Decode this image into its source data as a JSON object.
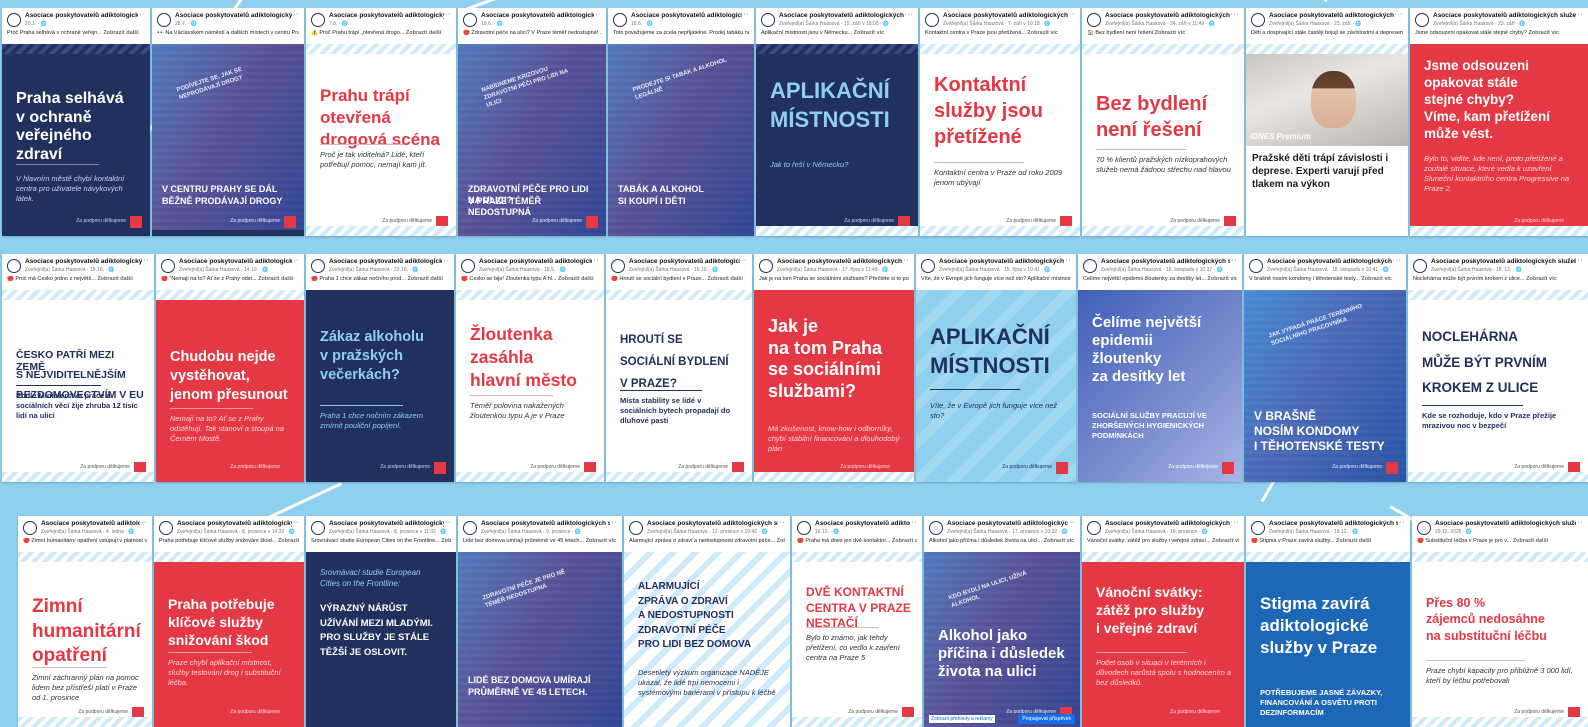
{
  "colors": {
    "background": "#8fd0ee",
    "navy": "#22305e",
    "red": "#e53845",
    "light_blue": "#8fd0ee",
    "white": "#ffffff"
  },
  "org_full": "Asociace poskytovatelů adiktologických služeb",
  "posts": [
    {
      "id": "r1c1",
      "org": "Asociace poskytovatelů adiktologických služeb",
      "meta": "20.1. · 🌐",
      "text": "Proč Praha selhává v ochraně veřejn...",
      "more": "Zobrazit další",
      "heading": [
        "Praha selhává",
        "v ochraně",
        "veřejného zdraví"
      ],
      "sub": "V hlavním městě chybí kontaktní centra pro uživatele návykových látek.",
      "credit": "Za podporu dělkujeme"
    },
    {
      "id": "r1c2",
      "org": "Asociace poskytovatelů adiktologických služeb",
      "meta": "28.7. · 🌐",
      "text": "👀 Na Václavském náměstí a dalších místech v centru Prahy se dál prodávají drogy.",
      "more": "Zobrazit další",
      "tilted": "Podívejte se, jak se neprodávají drogy",
      "caption": [
        "V CENTRU PRAHY SE DÁL",
        "BĚŽNĚ PRODÁVAJÍ DROGY"
      ],
      "credit": "Za podporu dělkujeme"
    },
    {
      "id": "r1c3",
      "org": "Asociace poskytovatelů adiktologických služeb",
      "meta": "7.8. · 🌐",
      "text": "⚠️ Proč Prahu trápí „otevřená drogo...",
      "more": "Zobrazit další",
      "heading": [
        "Prahu trápí",
        "otevřená",
        "drogová scéna"
      ],
      "sub": "Proč je tak viditelná? Lidé, kteří potřebují pomoc, nemají kam jít.",
      "credit": "Za podporu dělkujeme"
    },
    {
      "id": "r1c4",
      "org": "Asociace poskytovatelů adiktologických služeb",
      "meta": "19.6. · 🌐",
      "text": "🔴 Zdravotní péče na ulici? V Praze téměř nedostupná! ...",
      "more": "Zobrazit další",
      "tilted": "Nabídneme krizovou zdravotní péči pro lidi na ulici",
      "caption": [
        "ZDRAVOTNÍ PÉČE PRO LIDI NA ULICI?",
        "V PRAZE TÉMĚŘ NEDOSTUPNÁ"
      ],
      "credit": "Za podporu dělkujeme"
    },
    {
      "id": "r1c5",
      "org": "Asociace poskytovatelů adiktologických služeb",
      "meta": "16.6. · 🌐",
      "text": "Toto považujeme za zcela nepřijatelné. Prodej tabáku nezletilým cigarety nebo lihoviny? An...",
      "more": "Zobrazit další",
      "tilted": "Prodejte si tabák a alkohol legálně",
      "caption": [
        "TABÁK A ALKOHOL",
        "SI KOUPÍ I DĚTI"
      ],
      "credit": ""
    },
    {
      "id": "r1c6",
      "org": "Asociace poskytovatelů adiktologických služeb",
      "meta": "Zveřejnil(a) Šárka Haasová · 15. září v 18:00 · 🌐",
      "text": "Aplikační místnosti jsou v Německu...",
      "more": "Zobrazit víc",
      "heading": [
        "APLIKAČNÍ",
        "MÍSTNOSTI"
      ],
      "sub": "Jak to řeší v Německu?",
      "credit": "Za podporu dělkujeme"
    },
    {
      "id": "r1c7",
      "org": "Asociace poskytovatelů adiktologických služeb",
      "meta": "Zveřejnil(a) Šárka Haasová · 7. září v 10:18 · 🌐",
      "text": "Kontaktní centra v Praze jsou přetížená...",
      "more": "Zobrazit víc",
      "heading": [
        "Kontaktní",
        "služby jsou",
        "přetížené"
      ],
      "sub": "Kontaktní centra v Praze od roku 2009 jenom ubývají",
      "credit": "Za podporu dělkujeme"
    },
    {
      "id": "r1c8",
      "org": "Asociace poskytovatelů adiktologických služeb",
      "meta": "Zveřejnil(a) Šárka Haasová · 24. září v 11:49 · 🌐",
      "text": "🏠 Bez bydlení není řešení",
      "more": "Zobrazit víc",
      "heading": [
        "Bez bydlení",
        "není řešení"
      ],
      "sub": "70 % klientů pražských nízkoprahových služeb nemá žádnou střechu nad hlavou",
      "credit": "Za podporu dělkujeme"
    },
    {
      "id": "r1c9",
      "org": "Asociace poskytovatelů adiktologických služeb",
      "meta": "Zveřejnil(a) Šárka Haasová · 23. září · 🌐",
      "text": "Děti a dospívající stále častěji bojují se závislostmi a depresemi...",
      "more": "Zobrazit víc",
      "premium": "iDNES Premium",
      "news": "Pražské děti trápí závislosti i deprese. Experti varují před tlakem na výkon"
    },
    {
      "id": "r1c10",
      "org": "Asociace poskytovatelů adiktologických služeb",
      "meta": "Zveřejnil(a) Šárka Haasová · 23. září · 🌐",
      "text": "Jsme odsouzeni opakovat stále stejné chyby?",
      "more": "Zobrazit víc",
      "heading": [
        "Jsme odsouzeni",
        "opakovat stále",
        "stejné chyby?",
        "Víme, kam přetížení",
        "může vést."
      ],
      "sub": "Bylo to, vidíte, kde není, proto přetížené a zoufalé situace, které vedla k uzavření Sluneční kontaktního centra Progressive na Praze 2.",
      "credit": "Za podporu dělkujeme"
    },
    {
      "id": "r2c1",
      "org": "Asociace poskytovatelů adiktologických služeb",
      "meta": "Zveřejnil(a) Šárka Haasová · 15.10. · 🌐",
      "text": "🔴 Proč má Česko jedno z největš...",
      "more": "Zobrazit další",
      "heading": [
        "ČESKO PATŘÍ MEZI ZEMĚ",
        "S NEJVIDITELNĚJŠÍM",
        "BEZDOMOVECTVÍM V EU"
      ],
      "sub": "Podle Ministerstva práce a sociálních věcí žije zhruba 12 tisíc lidí na ulici",
      "credit": "Za podporu dělkujeme"
    },
    {
      "id": "r2c2",
      "org": "Asociace poskytovatelů adiktologických služeb",
      "meta": "Zveřejnil(a) Šárka Haasová · 14.10. · 🌐",
      "text": "🔴 \"Nemají na to? Ať se z Prahy odst...",
      "more": "Zobrazit další",
      "heading": [
        "Chudobu nejde",
        "vystěhovat,",
        "jenom přesunout"
      ],
      "sub": "Nemají na to? Ať se z Prahy odstěhují. Tak stanoví a stoupá na Černém Mostě.",
      "credit": "Za podporu dělkujeme"
    },
    {
      "id": "r2c3",
      "org": "Asociace poskytovatelů adiktologických služeb",
      "meta": "Zveřejnil(a) Šárka Haasová · 23.10. · 🌐",
      "text": "🔴 Praha 1 chce zákaz nočního prod...",
      "more": "Zobrazit další",
      "heading": [
        "Zákaz alkoholu",
        "v pražských",
        "večerkách?"
      ],
      "sub": "Praha 1 chce nočním zákazem zmírnit pouliční popíjení.",
      "credit": "Za podporu dělkujeme"
    },
    {
      "id": "r2c4",
      "org": "Asociace poskytovatelů adiktologických služeb",
      "meta": "Zveřejnil(a) Šárka Haasová · 18.9. · 🌐",
      "text": "🔴 Česko se bije! Žloutenka typu A hl...",
      "more": "Zobrazit další",
      "heading": [
        "Žloutenka",
        "zasáhla",
        "hlavní město"
      ],
      "sub": "Téměř polovina nakažených žloutenkou typu A je v Praze",
      "credit": "Za podporu dělkujeme"
    },
    {
      "id": "r2c5",
      "org": "Asociace poskytovatelů adiktologických služeb",
      "meta": "Zveřejnil(a) Šárka Haasová · 16.10. · 🌐",
      "text": "🔴 Hroutí se sociální bydlení v Praze...",
      "more": "Zobrazit další",
      "heading": [
        "HROUTÍ SE",
        "SOCIÁLNÍ BYDLENÍ",
        "V PRAZE?"
      ],
      "sub": "Místa stability se lidé v sociálních bytech propadají do dluhové pasti",
      "credit": "Za podporu dělkujeme"
    },
    {
      "id": "r2c6",
      "org": "Asociace poskytovatelů adiktologických služeb",
      "meta": "Zveřejnil(a) Šárka Haasová · 17. října v 11:49 · 🌐",
      "text": "Jak je na tom Praha se sociálními službami? Přečtěte si to podrobněji...",
      "more": "Zobrazit víc",
      "heading": [
        "Jak je",
        "na tom Praha",
        "se sociálními",
        "službami?"
      ],
      "sub": "Má zkušenost, know-how i odborníky, chybí stabilní financování a dlouhodobý plán",
      "credit": "Za podporu dělkujeme"
    },
    {
      "id": "r2c7",
      "org": "Asociace poskytovatelů adiktologických služeb",
      "meta": "Zveřejnil(a) Šárka Haasová · 15. října v 10:41 · 🌐",
      "text": "Víte, že v Evropě jich funguje více než sto? Aplikační místnosti...",
      "more": "Zobrazit víc",
      "heading": [
        "APLIKAČNÍ",
        "MÍSTNOSTI"
      ],
      "sub": "Víte, že v Evropě jich funguje více než sto?",
      "credit": "Za podporu dělkujeme"
    },
    {
      "id": "r2c8",
      "org": "Asociace poskytovatelů adiktologických služeb",
      "meta": "Zveřejnil(a) Šárka Haasová · 16. listopadu v 10:37 · 🌐",
      "text": "Čelíme největší epidemii žloutenky za desítky let...",
      "more": "Zobrazit víc",
      "heading": [
        "Čelíme největší",
        "epidemii",
        "žloutenky",
        "za desítky let"
      ],
      "sub": "SOCIÁLNÍ SLUŽBY PRACUJÍ VE ZHORŠENÝCH HYGIENICKÝCH PODMÍNKÁCH",
      "credit": "Za podporu dělkujeme"
    },
    {
      "id": "r2c9",
      "org": "Asociace poskytovatelů adiktologických služeb",
      "meta": "Zveřejnil(a) Šárka Haasová · 18. listopadu v 10:41 · 🌐",
      "text": "V brašně nosím kondomy i těhotenské testy...",
      "more": "Zobrazit víc",
      "tilted": "Jak vypadá práce terénního sociálního pracovníka",
      "caption": [
        "V BRAŠNĚ",
        "NOSÍM KONDOMY",
        "I TĚHOTENSKÉ TESTY"
      ],
      "credit": "Za podporu dělkujeme"
    },
    {
      "id": "r2c10",
      "org": "Asociace poskytovatelů adiktologických služeb",
      "meta": "Zveřejnil(a) Šárka Haasová · 18. 12. · 🌐",
      "text": "Noclehárna může být prvním krokem z ulice...",
      "more": "Zobrazit víc",
      "heading": [
        "NOCLEHÁRNA",
        "MŮŽE BÝT PRVNÍM",
        "KROKEM Z ULICE"
      ],
      "sub": "Kde se rozhoduje, kdo v Praze přežije mrazivou noc v bezpečí",
      "credit": "Za podporu dělkujeme"
    },
    {
      "id": "r3c1",
      "org": "Asociace poskytovatelů adiktologických služeb",
      "meta": "Zveřejnil(a) Šárka Haasová · 4. ledna · 🌐",
      "text": "🔴 Zimní humanitární opatření vstupují v platnost v posledních 1. prosince...",
      "more": "Zobrazit další",
      "heading": [
        "Zimní",
        "humanitární",
        "opatření"
      ],
      "sub": "Zimní záchranný plán na pomoc lidem bez přístřeší platí v Praze od 1. prosince",
      "credit": "Za podporu dělkujeme"
    },
    {
      "id": "r3c2",
      "org": "Asociace poskytovatelů adiktologických služeb",
      "meta": "Zveřejnil(a) Šárka Haasová · 8. prosince v 14:33 · 🌐",
      "text": "Praha potřebuje klíčové služby snižování škod...",
      "more": "Zobrazit víc",
      "heading": [
        "Praha potřebuje",
        "klíčové služby",
        "snižování škod"
      ],
      "sub": "Praze chybí aplikační místnost, služby testování drog i substituční léčba.",
      "credit": "Za podporu dělkujeme"
    },
    {
      "id": "r3c3",
      "org": "Asociace poskytovatelů adiktologických služeb",
      "meta": "Zveřejnil(a) Šárka Haasová · 8. prosince v 11:02 · 🌐",
      "text": "Srovnávací studie European Cities on the Frontline...",
      "more": "Zobrazit víc",
      "lead": [
        "Srovnávací studie European",
        "Cities on the Frontline:"
      ],
      "heading": [
        "VÝRAZNÝ NÁRŮST",
        "UŽÍVÁNÍ MEZI MLADÝMI.",
        "PRO SLUŽBY JE STÁLE",
        "TĚŽŠÍ JE OSLOVIT."
      ],
      "credit": ""
    },
    {
      "id": "r3c4",
      "org": "Asociace poskytovatelů adiktologických služeb",
      "meta": "Zveřejnil(a) Šárka Haasová · 9. prosince · 🌐",
      "text": "Lidé bez domova umírají průměrně ve 45 letech...",
      "more": "Zobrazit víc",
      "tilted": "Zdravotní péče je pro ně téměř nedostupná",
      "caption": [
        "LIDÉ BEZ DOMOVA UMÍRAJÍ",
        "PRŮMĚRNĚ VE 45 LETECH."
      ],
      "credit": ""
    },
    {
      "id": "r3c5",
      "org": "Asociace poskytovatelů adiktologických služeb",
      "meta": "Zveřejnil(a) Šárka Haasová · 12. prosince v 10:42 · 🌐",
      "text": "Alarmující zpráva o zdraví a nedostupnosti zdravotní péče...",
      "more": "Zobrazit víc",
      "heading": [
        "ALARMUJÍCÍ",
        "ZPRÁVA O ZDRAVÍ",
        "A NEDOSTUPNOSTI",
        "ZDRAVOTNÍ PÉČE",
        "PRO LIDI BEZ DOMOVA"
      ],
      "sub": "Desetiletý výzkum organizace NADĚJE ukázal, že lidé trpí nemocemi i systémovými bariérami v přístupu k léčbě",
      "credit": ""
    },
    {
      "id": "r3c6",
      "org": "Asociace poskytovatelů adiktologických služeb",
      "meta": "16.12. · 🌐",
      "text": "🔴 Praha má dnes jen dvě kontaktní...",
      "more": "Zobrazit další",
      "heading": [
        "DVĚ KONTAKTNÍ",
        "CENTRA V PRAZE",
        "NESTAČÍ"
      ],
      "sub": "Bylo to známo, jak tehdy přetížení, co vedlo k zavření centra na Praze 5",
      "credit": "Za podporu dělkujeme"
    },
    {
      "id": "r3c7",
      "org": "Asociace poskytovatelů adiktologických služeb",
      "meta": "Zveřejnil(a) Šárka Haasová · 17. prosince v 10:32 · 🌐",
      "text": "Alkohol jako příčina i důsledek života na ulici...",
      "more": "Zobrazit víc",
      "tilted": "Kdo bydlí na ulici, užívá alkohol",
      "heading": [
        "Alkohol jako",
        "příčina i důsledek",
        "života na ulici"
      ],
      "credit": "Za podporu dělkujeme",
      "footer_left": "Zobrazit přehledy a reklamy",
      "footer_btn": "Propagovat příspěvek"
    },
    {
      "id": "r3c8",
      "org": "Asociace poskytovatelů adiktologických služeb",
      "meta": "Zveřejnil(a) Šárka Haasová · 19. prosince · 🌐",
      "text": "Vánoční svátky: zátěž pro služby i veřejné zdraví...",
      "more": "Zobrazit víc",
      "heading": [
        "Vánoční svátky:",
        "zátěž pro služby",
        "i veřejné zdraví"
      ],
      "sub": "Počet osob v situaci v terénních i důvodech narůstá spolu s hodnocením a bez důsledků.",
      "credit": "Za podporu dělkujeme"
    },
    {
      "id": "r3c9",
      "org": "Asociace poskytovatelů adiktologických služeb",
      "meta": "Zveřejnil(a) Šárka Haasová · 19.12. · 🌐",
      "text": "🔴 Stigma v Praze zavírá služby...",
      "more": "Zobrazit další",
      "heading": [
        "Stigma zavírá",
        "adiktologické",
        "služby v Praze"
      ],
      "sub": "POTŘEBUJEME JASNÉ ZÁVAZKY, FINANCOVÁNÍ A OSVĚTU PROTI DEZINFORMACÍM",
      "credit": ""
    },
    {
      "id": "r3c10",
      "org": "Asociace poskytovatelů adiktologických služeb",
      "meta": "29.12. 2025 · 🌐",
      "text": "🔴 Substituční léčba v Praze je pro v...",
      "more": "Zobrazit další",
      "heading": [
        "Přes 80 %",
        "zájemců nedosáhne",
        "na substituční léčbu"
      ],
      "sub": "Praze chybí kapacity pro přibližně 3 000 lidí, kteří by léčbu potřebovali",
      "credit": "Za podporu dělkujeme"
    }
  ]
}
